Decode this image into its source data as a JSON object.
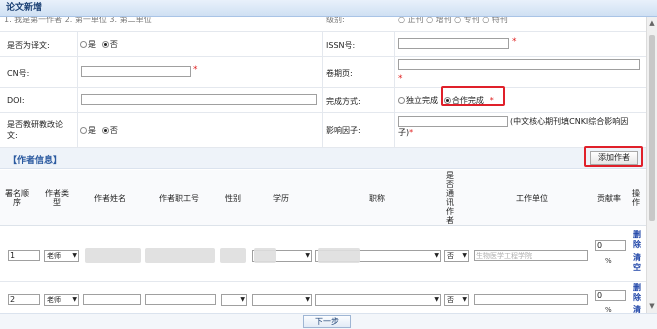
{
  "title": "论文新增",
  "cut_row_fragments": {
    "left": "1. 我是第一作者  2. 第一单位  3. 第二单位",
    "right_label": "级别:",
    "right_text": "○ 正刊  ○ 增刊  ○ 专刊  ○ 特刊"
  },
  "form": {
    "translated_label": "是否为译文:",
    "yes": "是",
    "no": "否",
    "issn_label": "ISSN号:",
    "cn_label": "CN号:",
    "volume_label": "卷期页:",
    "doi_label": "DOI:",
    "completion_label": "完成方式:",
    "independent": "独立完成",
    "cooperative": "合作完成",
    "reform_label": "是否教研教改论文:",
    "impact_label": "影响因子:",
    "impact_hint": "(中文核心期刊填CNKI综合影响因子)"
  },
  "authors_section": {
    "title": "【作者信息】",
    "add_button": "添加作者",
    "headers": [
      "署名顺序",
      "作者类型",
      "作者姓名",
      "作者职工号",
      "性别",
      "学历",
      "职称",
      "是否通讯作者",
      "工作单位",
      "贡献率",
      "操作"
    ],
    "rows": [
      {
        "order": "1",
        "type": "老师",
        "corresponding": "否",
        "unit_placeholder": "生物医学工程学院",
        "rate": "0",
        "pct": "%",
        "delete": "删除",
        "clear": "清空"
      },
      {
        "order": "2",
        "type": "老师",
        "corresponding": "否",
        "unit_placeholder": "",
        "rate": "0",
        "pct": "%",
        "delete": "删除",
        "clear": "清空"
      }
    ]
  },
  "footer": {
    "next": "下一步"
  },
  "colors": {
    "required": "#e02020",
    "highlight": "#e0202a",
    "section_title": "#2b5aa0"
  }
}
